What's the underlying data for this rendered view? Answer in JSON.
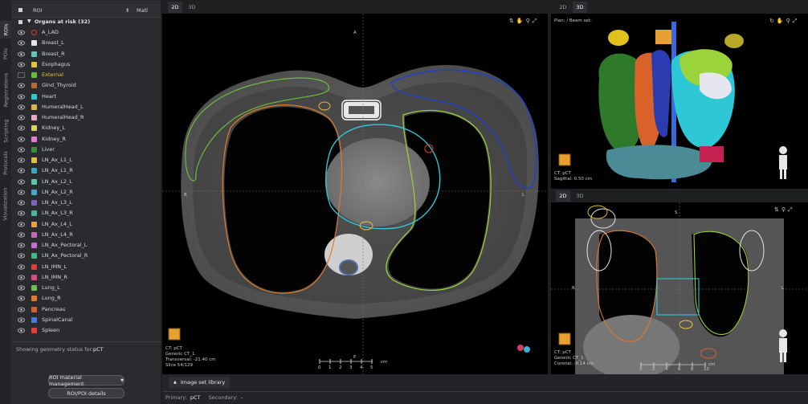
{
  "side_tabs": [
    "ROIs",
    "POIs",
    "Registrations",
    "Scripting",
    "Protocols",
    "Visualization"
  ],
  "roi_panel": {
    "header_label": "ROI",
    "header_right": "Matl",
    "group_label": "Organs at risk (32)",
    "items": [
      {
        "label": "A_LAD",
        "color": "#e0362b",
        "hollow": true
      },
      {
        "label": "Breast_L",
        "color": "#e6e6e6"
      },
      {
        "label": "Breast_R",
        "color": "#62c6b2"
      },
      {
        "label": "Esophagus",
        "color": "#e8c23c"
      },
      {
        "label": "External",
        "color": "#6dbb3f",
        "highlight": true
      },
      {
        "label": "Glnd_Thyroid",
        "color": "#b46a2f"
      },
      {
        "label": "Heart",
        "color": "#2ec7d6"
      },
      {
        "label": "HumeralHead_L",
        "color": "#e0b24a"
      },
      {
        "label": "HumeralHead_R",
        "color": "#e8a8c0"
      },
      {
        "label": "Kidney_L",
        "color": "#d9d25b"
      },
      {
        "label": "Kidney_R",
        "color": "#e37fd8"
      },
      {
        "label": "Liver",
        "color": "#3f8c3c"
      },
      {
        "label": "LN_Ax_L1_L",
        "color": "#e3c23c"
      },
      {
        "label": "LN_Ax_L1_R",
        "color": "#36a6c8"
      },
      {
        "label": "LN_Ax_L2_L",
        "color": "#5ac7a6"
      },
      {
        "label": "LN_Ax_L2_R",
        "color": "#3faacc"
      },
      {
        "label": "LN_Ax_L3_L",
        "color": "#7e62c4"
      },
      {
        "label": "LN_Ax_L3_R",
        "color": "#4db3a2"
      },
      {
        "label": "LN_Ax_L4_L",
        "color": "#e6a04a"
      },
      {
        "label": "LN_Ax_L4_R",
        "color": "#c46ab4"
      },
      {
        "label": "LN_Ax_Pectoral_L",
        "color": "#c66ad8"
      },
      {
        "label": "LN_Ax_Pectoral_R",
        "color": "#43b884"
      },
      {
        "label": "LN_IMN_L",
        "color": "#e03a3a"
      },
      {
        "label": "LN_IMN_R",
        "color": "#d94a8a"
      },
      {
        "label": "Lung_L",
        "color": "#6cc14a"
      },
      {
        "label": "Lung_R",
        "color": "#e07a2a"
      },
      {
        "label": "Pancreas",
        "color": "#d9622a"
      },
      {
        "label": "SpinalCanal",
        "color": "#4a7ad9"
      },
      {
        "label": "Spleen",
        "color": "#e0403a"
      }
    ],
    "geometry_status_label": "Showing geometry status for:",
    "geometry_status_value": "pCT",
    "btn_material": "ROI material management",
    "btn_details": "ROI/POI details"
  },
  "main_view": {
    "tabs": [
      "2D",
      "3D"
    ],
    "orient_top": "A",
    "orient_left": "R",
    "orient_right": "L",
    "orient_bottom": "P",
    "info_lines": [
      "CT: pCT",
      "Generic CT_1",
      "Transversal: -21.40 cm",
      "Slice 54/129"
    ],
    "scale_labels": [
      "0",
      "1",
      "2",
      "3",
      "4",
      "5"
    ],
    "scale_unit": "cm"
  },
  "view_3d": {
    "tabs": [
      "2D",
      "3D"
    ],
    "title": "Plan: / Beam set:",
    "info_lines": [
      "CT: pCT",
      "Sagittal: 0.50 cm"
    ]
  },
  "coronal_view": {
    "tabs": [
      "2D",
      "3D"
    ],
    "orient_top": "S",
    "orient_left": "R",
    "orient_right": "L",
    "info_lines": [
      "CT: pCT",
      "Generic CT_1",
      "Coronal: -0.14 cm"
    ],
    "scale_labels": [
      "0",
      "2",
      "4",
      "6",
      "8",
      "10"
    ],
    "scale_unit": "cm"
  },
  "bottom": {
    "library_label": "Image set library",
    "primary_label": "Primary:",
    "primary_value": "pCT",
    "secondary_label": "Secondary:",
    "secondary_value": "-"
  }
}
